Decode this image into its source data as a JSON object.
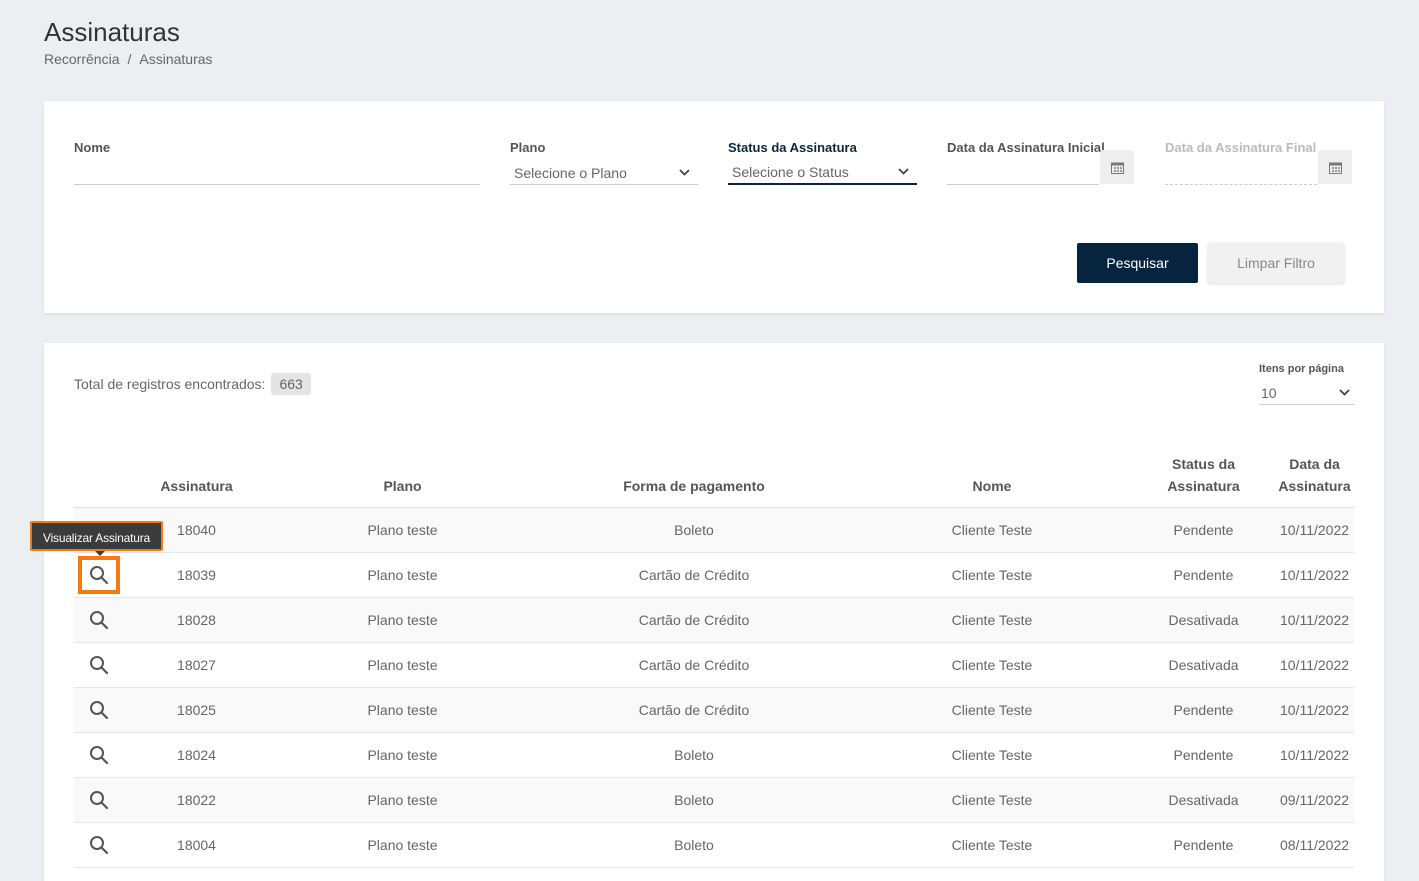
{
  "page": {
    "title": "Assinaturas"
  },
  "breadcrumb": {
    "parent": "Recorrência",
    "separator": "/",
    "current": "Assinaturas"
  },
  "filters": {
    "nome_label": "Nome",
    "nome_value": "",
    "plano_label": "Plano",
    "plano_value": "Selecione o Plano",
    "status_label": "Status da Assinatura",
    "status_value": "Selecione o Status",
    "data_inicial_label": "Data da Assinatura Inicial",
    "data_final_label": "Data da Assinatura Final",
    "search_button": "Pesquisar",
    "clear_button": "Limpar Filtro"
  },
  "list": {
    "total_label": "Total de registros encontrados:",
    "total_count": "663",
    "per_page_label": "Itens por página",
    "per_page_value": "10",
    "tooltip": "Visualizar Assinatura",
    "headers": {
      "assinatura": "Assinatura",
      "plano": "Plano",
      "forma": "Forma de pagamento",
      "nome": "Nome",
      "status_line1": "Status da",
      "status_line2": "Assinatura",
      "data_line1": "Data da",
      "data_line2": "Assinatura"
    },
    "rows": [
      {
        "id": "18040",
        "plano": "Plano teste",
        "forma": "Boleto",
        "nome": "Cliente Teste",
        "status": "Pendente",
        "data": "10/11/2022"
      },
      {
        "id": "18039",
        "plano": "Plano teste",
        "forma": "Cartão de Crédito",
        "nome": "Cliente Teste",
        "status": "Pendente",
        "data": "10/11/2022"
      },
      {
        "id": "18028",
        "plano": "Plano teste",
        "forma": "Cartão de Crédito",
        "nome": "Cliente Teste",
        "status": "Desativada",
        "data": "10/11/2022"
      },
      {
        "id": "18027",
        "plano": "Plano teste",
        "forma": "Cartão de Crédito",
        "nome": "Cliente Teste",
        "status": "Desativada",
        "data": "10/11/2022"
      },
      {
        "id": "18025",
        "plano": "Plano teste",
        "forma": "Cartão de Crédito",
        "nome": "Cliente Teste",
        "status": "Pendente",
        "data": "10/11/2022"
      },
      {
        "id": "18024",
        "plano": "Plano teste",
        "forma": "Boleto",
        "nome": "Cliente Teste",
        "status": "Pendente",
        "data": "10/11/2022"
      },
      {
        "id": "18022",
        "plano": "Plano teste",
        "forma": "Boleto",
        "nome": "Cliente Teste",
        "status": "Desativada",
        "data": "09/11/2022"
      },
      {
        "id": "18004",
        "plano": "Plano teste",
        "forma": "Boleto",
        "nome": "Cliente Teste",
        "status": "Pendente",
        "data": "08/11/2022"
      }
    ]
  },
  "colors": {
    "primary": "#06243d",
    "highlight": "#f47b10",
    "background": "#eceff2"
  }
}
